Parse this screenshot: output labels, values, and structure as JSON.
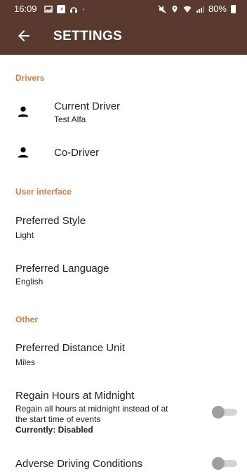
{
  "status_bar": {
    "time": "16:09",
    "battery": "80%"
  },
  "app_bar": {
    "title": "SETTINGS"
  },
  "sections": {
    "drivers": "Drivers",
    "ui": "User interface",
    "other": "Other"
  },
  "drivers": {
    "current_driver": {
      "title": "Current Driver",
      "value": "Test Alfa"
    },
    "co_driver": {
      "title": "Co-Driver"
    }
  },
  "ui": {
    "style": {
      "title": "Preferred Style",
      "value": "Light"
    },
    "language": {
      "title": "Preferred Language",
      "value": "English"
    }
  },
  "other": {
    "distance": {
      "title": "Preferred Distance Unit",
      "value": "Miles"
    },
    "regain": {
      "title": "Regain Hours at Midnight",
      "desc_line1": "Regain all hours at midnight instead of at",
      "desc_line2": "the start time of events",
      "status": "Currently: Disabled",
      "enabled": false
    },
    "adverse": {
      "title": "Adverse Driving Conditions",
      "enabled": false
    }
  },
  "colors": {
    "bar": "#5a3a2e",
    "accent": "#e6783d",
    "toggle_off": "#9e9e9e"
  }
}
